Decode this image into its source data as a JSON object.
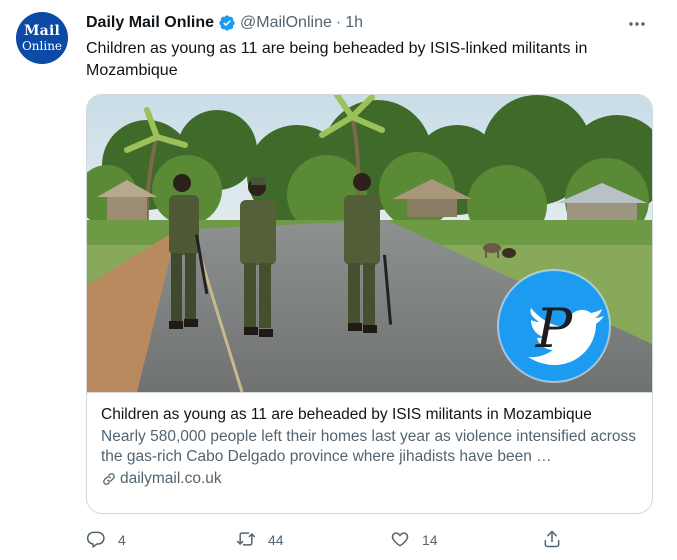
{
  "author": {
    "avatar_line1": "Mail",
    "avatar_line2": "Online",
    "name": "Daily Mail Online",
    "handle": "@MailOnline",
    "separator": "·",
    "time": "1h",
    "verified": true
  },
  "tweet": {
    "text": "Children as young as 11 are being beheaded by ISIS-linked militants in Mozambique"
  },
  "card": {
    "title": "Children as young as 11 are beheaded by ISIS militants in Mozambique",
    "description": "Nearly 580,000 people left their homes last year as violence intensified across the gas-rich Cabo Delgado province where jihadists have been …",
    "domain": "dailymail.co.uk",
    "watermark_letter": "P"
  },
  "actions": {
    "reply_count": "4",
    "retweet_count": "44",
    "like_count": "14"
  },
  "icons": {
    "verified": "verified-badge-icon",
    "more": "more-dots-icon",
    "link": "link-icon",
    "reply": "reply-icon",
    "retweet": "retweet-icon",
    "like": "heart-icon",
    "share": "share-icon"
  },
  "colors": {
    "accent": "#1d9bf0",
    "avatar_bg": "#0b4aa5",
    "secondary_text": "#536471",
    "border": "#cfd9de"
  }
}
